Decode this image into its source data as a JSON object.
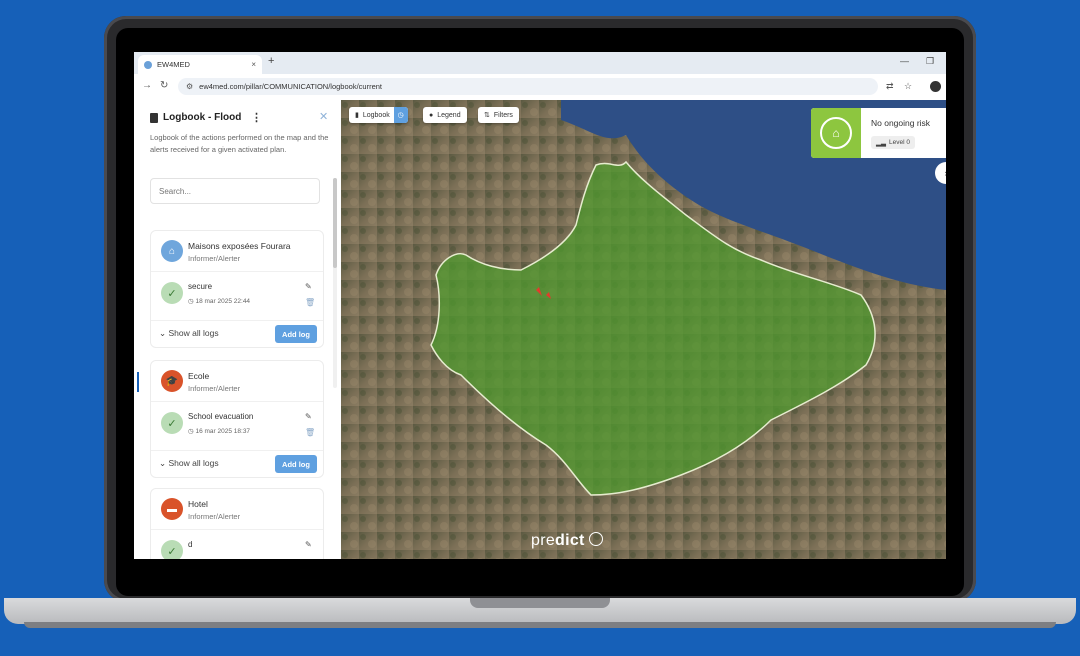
{
  "browser": {
    "tab_title": "EW4MED",
    "tab_close": "×",
    "new_tab": "+",
    "minimize": "—",
    "restore": "❐",
    "url": "ew4med.com/pillar/COMMUNICATION/logbook/current"
  },
  "sidebar": {
    "title": "Logbook - Flood",
    "description": "Logbook of the actions performed on the map and the alerts received for a given activated plan.",
    "search_placeholder": "Search...",
    "cards": [
      {
        "title": "Maisons exposées Fourara",
        "subtitle": "Informer/Alerter",
        "icon": "house-icon",
        "icon_color": "#e0773a",
        "log_title": "secure",
        "log_date": "18 mar 2025 22:44",
        "show_all": "Show all logs",
        "add_log": "Add log"
      },
      {
        "title": "Ecole",
        "subtitle": "Informer/Alerter",
        "icon": "graduation-cap-icon",
        "icon_color": "#d9532a",
        "log_title": "School evacuation",
        "log_date": "16 mar 2025 18:37",
        "show_all": "Show all logs",
        "add_log": "Add log"
      },
      {
        "title": "Hotel",
        "subtitle": "Informer/Alerter",
        "icon": "bed-icon",
        "icon_color": "#d9532a",
        "log_title": "d"
      }
    ]
  },
  "map": {
    "buttons": {
      "logbook": "Logbook",
      "legend": "Legend",
      "filters": "Filters"
    },
    "risk": {
      "title": "No ongoing risk",
      "level": "Level 0",
      "color": "#8dc63f"
    },
    "brand": {
      "pre": "pre",
      "bold": "dict"
    }
  },
  "colors": {
    "background": "#1660b8",
    "accent": "#5fa0e0",
    "region_fill": "#4f9a2e"
  }
}
